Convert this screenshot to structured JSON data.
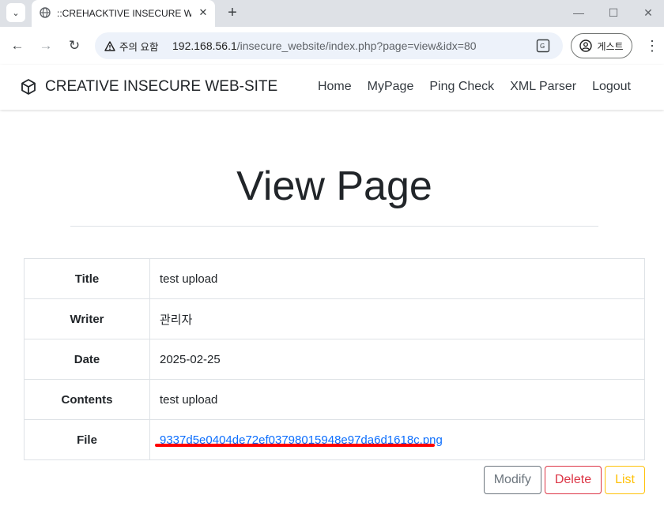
{
  "browser": {
    "tab_title": "::CREHACKTIVE INSECURE WEB",
    "warning_label": "주의 요함",
    "url_host": "192.168.56.1",
    "url_path": "/insecure_website/index.php?page=view&idx=80",
    "profile_label": "게스트"
  },
  "site": {
    "brand": "CREATIVE INSECURE WEB-SITE",
    "nav": [
      "Home",
      "MyPage",
      "Ping Check",
      "XML Parser",
      "Logout"
    ]
  },
  "page": {
    "heading": "View Page",
    "rows": [
      {
        "label": "Title",
        "value": "test upload"
      },
      {
        "label": "Writer",
        "value": "관리자"
      },
      {
        "label": "Date",
        "value": "2025-02-25"
      },
      {
        "label": "Contents",
        "value": "test upload"
      },
      {
        "label": "File",
        "value": "9337d5e0404de72ef03798015948e97da6d1618c.png"
      }
    ],
    "buttons": {
      "modify": "Modify",
      "delete": "Delete",
      "list": "List"
    }
  },
  "colors": {
    "link": "#0d6efd",
    "annotation_underline": "#ff0000",
    "delete": "#dc3545",
    "list": "#ffc107",
    "modify": "#6c757d"
  },
  "icons": [
    "tab-menu-icon",
    "globe-icon",
    "close-icon",
    "plus-icon",
    "minimize-icon",
    "maximize-icon",
    "back-icon",
    "forward-icon",
    "reload-icon",
    "warning-icon",
    "translate-icon",
    "profile-icon",
    "kebab-menu-icon",
    "cube-icon"
  ]
}
